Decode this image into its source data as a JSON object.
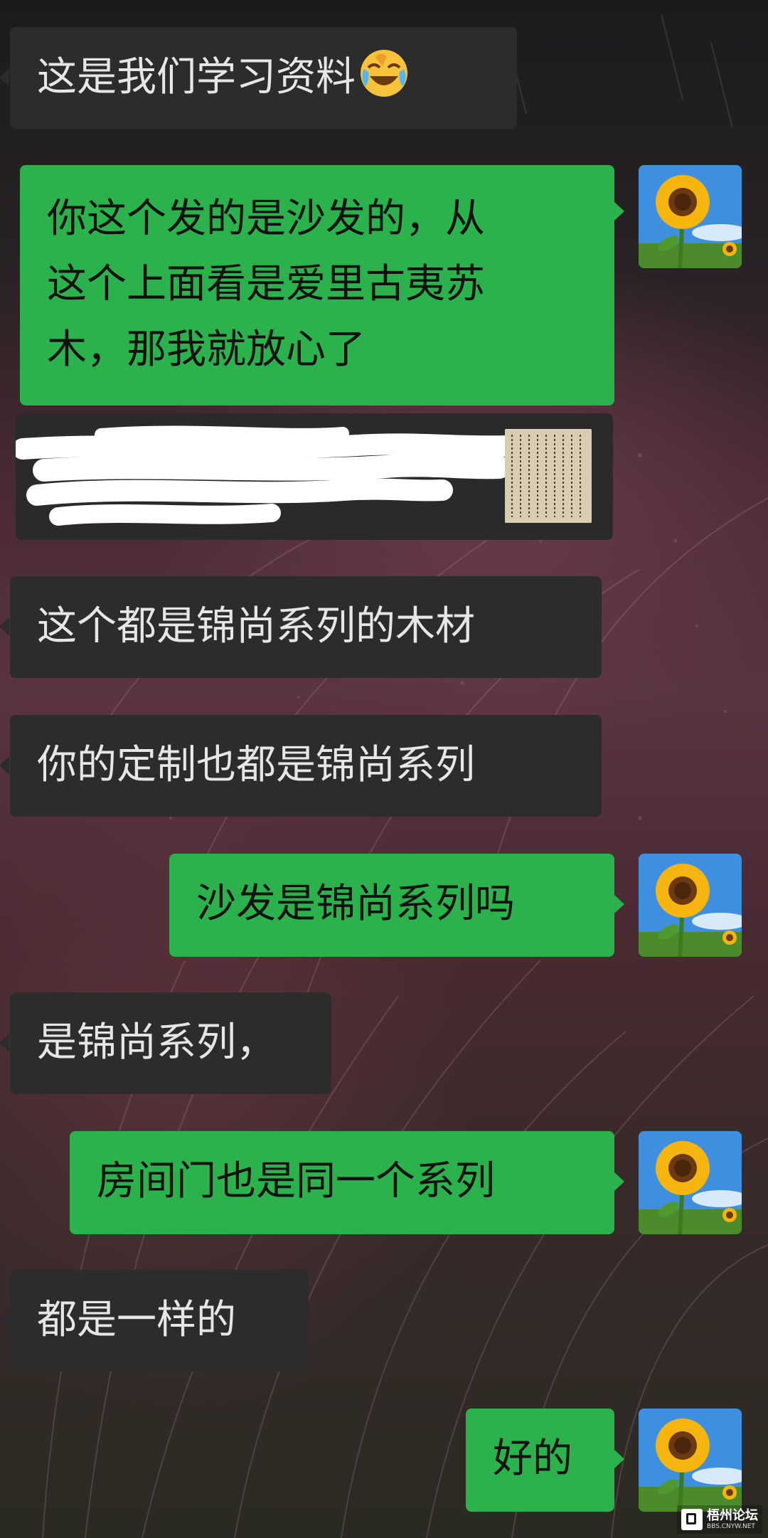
{
  "chat": {
    "messages": [
      {
        "side": "in",
        "text": "这是我们学习资料",
        "emoji": "laughing-crying-emoji"
      },
      {
        "side": "out",
        "lines": [
          "你这个发的是沙发的，从",
          "这个上面看是爱里古夷苏",
          "木，那我就放心了"
        ]
      },
      {
        "side": "in",
        "text": "这个都是锦尚系列的木材"
      },
      {
        "side": "in",
        "text": "你的定制也都是锦尚系列"
      },
      {
        "side": "out",
        "text": "沙发是锦尚系列吗"
      },
      {
        "side": "in",
        "text": "是锦尚系列，"
      },
      {
        "side": "out",
        "text": "房间门也是同一个系列"
      },
      {
        "side": "in",
        "text": "都是一样的"
      },
      {
        "side": "out",
        "text": "好的"
      }
    ],
    "avatar_icon": "sunflower-avatar",
    "quoted_message": {
      "thumbnail_icon": "document-thumbnail-icon",
      "redacted": true
    }
  },
  "watermark": {
    "name": "梧州论坛",
    "url": "BBS.CNYW.NET"
  },
  "colors": {
    "incoming_bubble": "#2c2c2c",
    "outgoing_bubble": "#2bb24c",
    "incoming_text": "#e6e6e6",
    "outgoing_text": "#111111"
  }
}
